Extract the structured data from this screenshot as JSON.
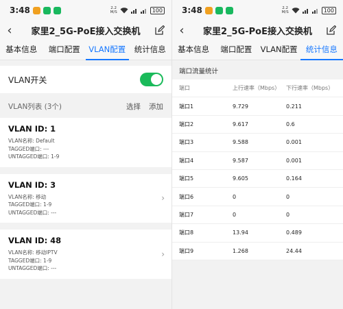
{
  "left": {
    "status": {
      "time": "3:48",
      "net_speed_top": "2.2",
      "net_speed_bottom": "M/S",
      "battery": "100"
    },
    "title": "家里2_5G-PoE接入交换机",
    "tabs": [
      "基本信息",
      "端口配置",
      "VLAN配置",
      "统计信息"
    ],
    "active_tab": 2,
    "vlan_switch": {
      "label": "VLAN开关",
      "enabled": true
    },
    "vlan_list": {
      "header": "VLAN列表 (3个)",
      "select_label": "选择",
      "add_label": "添加",
      "items": [
        {
          "id": "VLAN ID: 1",
          "name": "VLAN名称: Default",
          "tagged": "TAGGED端口: ---",
          "untagged": "UNTAGGED端口: 1-9",
          "chevron": false
        },
        {
          "id": "VLAN ID: 3",
          "name": "VLAN名称: 移动",
          "tagged": "TAGGED端口: 1-9",
          "untagged": "UNTAGGED端口: ---",
          "chevron": true
        },
        {
          "id": "VLAN ID: 48",
          "name": "VLAN名称: 移动IPTV",
          "tagged": "TAGGED端口: 1-9",
          "untagged": "UNTAGGED端口: ---",
          "chevron": true
        }
      ]
    }
  },
  "right": {
    "status": {
      "time": "3:48",
      "net_speed_top": "2.2",
      "net_speed_bottom": "M/S",
      "battery": "100"
    },
    "title": "家里2_5G-PoE接入交换机",
    "tabs": [
      "基本信息",
      "端口配置",
      "VLAN配置",
      "统计信息"
    ],
    "active_tab": 3,
    "stats": {
      "title": "端口流量统计",
      "columns": [
        "端口",
        "上行速率（Mbps）",
        "下行速率（Mbps）"
      ],
      "rows": [
        [
          "端口1",
          "9.729",
          "0.211"
        ],
        [
          "端口2",
          "9.617",
          "0.6"
        ],
        [
          "端口3",
          "9.588",
          "0.001"
        ],
        [
          "端口4",
          "9.587",
          "0.001"
        ],
        [
          "端口5",
          "9.605",
          "0.164"
        ],
        [
          "端口6",
          "0",
          "0"
        ],
        [
          "端口7",
          "0",
          "0"
        ],
        [
          "端口8",
          "13.94",
          "0.489"
        ],
        [
          "端口9",
          "1.268",
          "24.44"
        ]
      ]
    }
  },
  "colors": {
    "accent": "#1677ff",
    "toggle_on": "#1aba5a",
    "notif_orange": "#f0a020",
    "notif_green": "#19b85e"
  }
}
